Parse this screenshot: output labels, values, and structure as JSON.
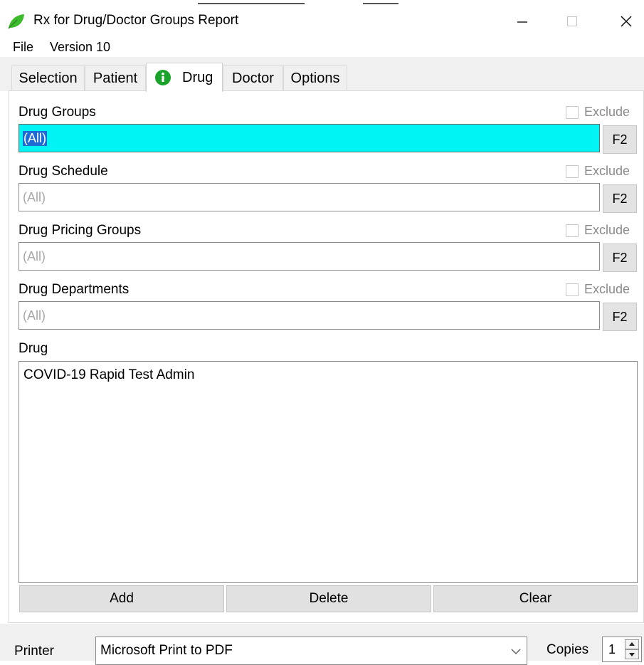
{
  "window": {
    "title": "Rx for Drug/Doctor Groups Report",
    "icon": "leaf-icon",
    "controls": [
      "minimize-icon",
      "maximize-icon",
      "close-icon"
    ]
  },
  "menu": {
    "file": "File",
    "version": "Version 10"
  },
  "tabs": [
    {
      "label": "Selection"
    },
    {
      "label": "Patient"
    },
    {
      "label": "Drug",
      "active": true,
      "icon": "info-icon"
    },
    {
      "label": "Doctor"
    },
    {
      "label": "Options"
    }
  ],
  "drug_groups": {
    "label": "Drug Groups",
    "exclude": "Exclude",
    "value": "(All)",
    "button": "F2"
  },
  "drug_schedule": {
    "label": "Drug Schedule",
    "exclude": "Exclude",
    "value": "(All)",
    "button": "F2"
  },
  "drug_pricing_groups": {
    "label": "Drug Pricing Groups",
    "exclude": "Exclude",
    "value": "(All)",
    "button": "F2"
  },
  "drug_departments": {
    "label": "Drug Departments",
    "exclude": "Exclude",
    "value": "(All)",
    "button": "F2"
  },
  "drug": {
    "label": "Drug",
    "items": [
      "COVID-19 Rapid Test Admin"
    ]
  },
  "buttons": {
    "add": "Add",
    "delete": "Delete",
    "clear": "Clear"
  },
  "printer": {
    "label": "Printer",
    "value": "Microsoft Print to PDF"
  },
  "copies": {
    "label": "Copies",
    "value": "1"
  },
  "colors": {
    "focus_field": "#00f4f4",
    "selection": "#1f6bd6",
    "info_icon": "#1aa32a",
    "leaf_icon": "#3dbb2c"
  }
}
